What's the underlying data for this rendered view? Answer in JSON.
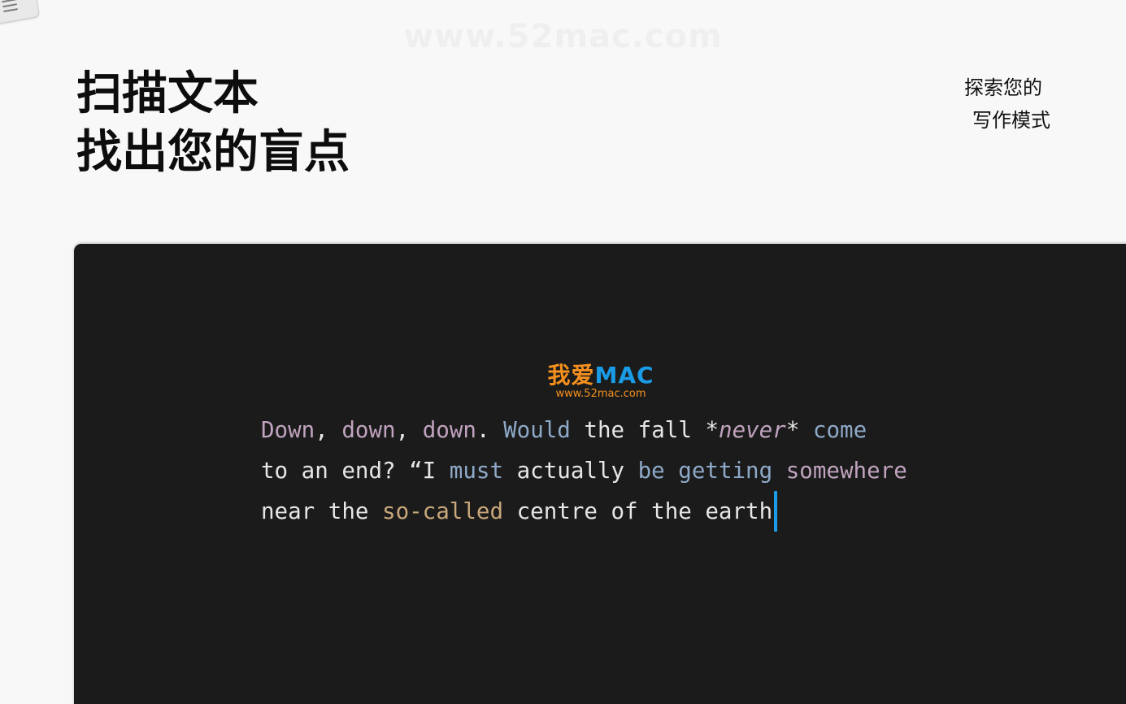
{
  "watermark": "www.52mac.com",
  "headline": {
    "line1": "扫描文本",
    "line2": "找出您的盲点"
  },
  "side_note": {
    "line1": "探索您的",
    "line2": "写作模式"
  },
  "logo": {
    "cn": "我爱",
    "en": "MAC",
    "url": "www.52mac.com"
  },
  "editor": {
    "lines": [
      [
        {
          "text": "Down",
          "kind": "adverb"
        },
        {
          "text": ", ",
          "kind": "plain"
        },
        {
          "text": "down",
          "kind": "adverb"
        },
        {
          "text": ", ",
          "kind": "plain"
        },
        {
          "text": "down",
          "kind": "adverb"
        },
        {
          "text": ". ",
          "kind": "plain"
        },
        {
          "text": "Would",
          "kind": "verb"
        },
        {
          "text": " the fall ",
          "kind": "plain"
        },
        {
          "text": "*",
          "kind": "star"
        },
        {
          "text": "never",
          "kind": "em"
        },
        {
          "text": "*",
          "kind": "star"
        },
        {
          "text": " ",
          "kind": "plain"
        },
        {
          "text": "come",
          "kind": "verb"
        }
      ],
      [
        {
          "text": "to an end? “I ",
          "kind": "plain"
        },
        {
          "text": "must",
          "kind": "verb"
        },
        {
          "text": " actually ",
          "kind": "plain"
        },
        {
          "text": "be getting",
          "kind": "verb"
        },
        {
          "text": " ",
          "kind": "plain"
        },
        {
          "text": "somewhere",
          "kind": "adverb"
        }
      ],
      [
        {
          "text": "near the ",
          "kind": "plain"
        },
        {
          "text": "so-called",
          "kind": "conj"
        },
        {
          "text": " centre of the earth",
          "kind": "plain"
        }
      ]
    ]
  },
  "colors": {
    "background": "#f8f8f8",
    "editor_bg": "#1b1b1b",
    "adverb": "#c0a3be",
    "verb": "#8ea9c8",
    "conjunction": "#c8a77a",
    "text": "#e6e6e6",
    "caret": "#1e9be8",
    "logo_orange": "#f5901e",
    "logo_blue": "#1a9be6"
  },
  "icons": {
    "corner": "document-icon"
  }
}
